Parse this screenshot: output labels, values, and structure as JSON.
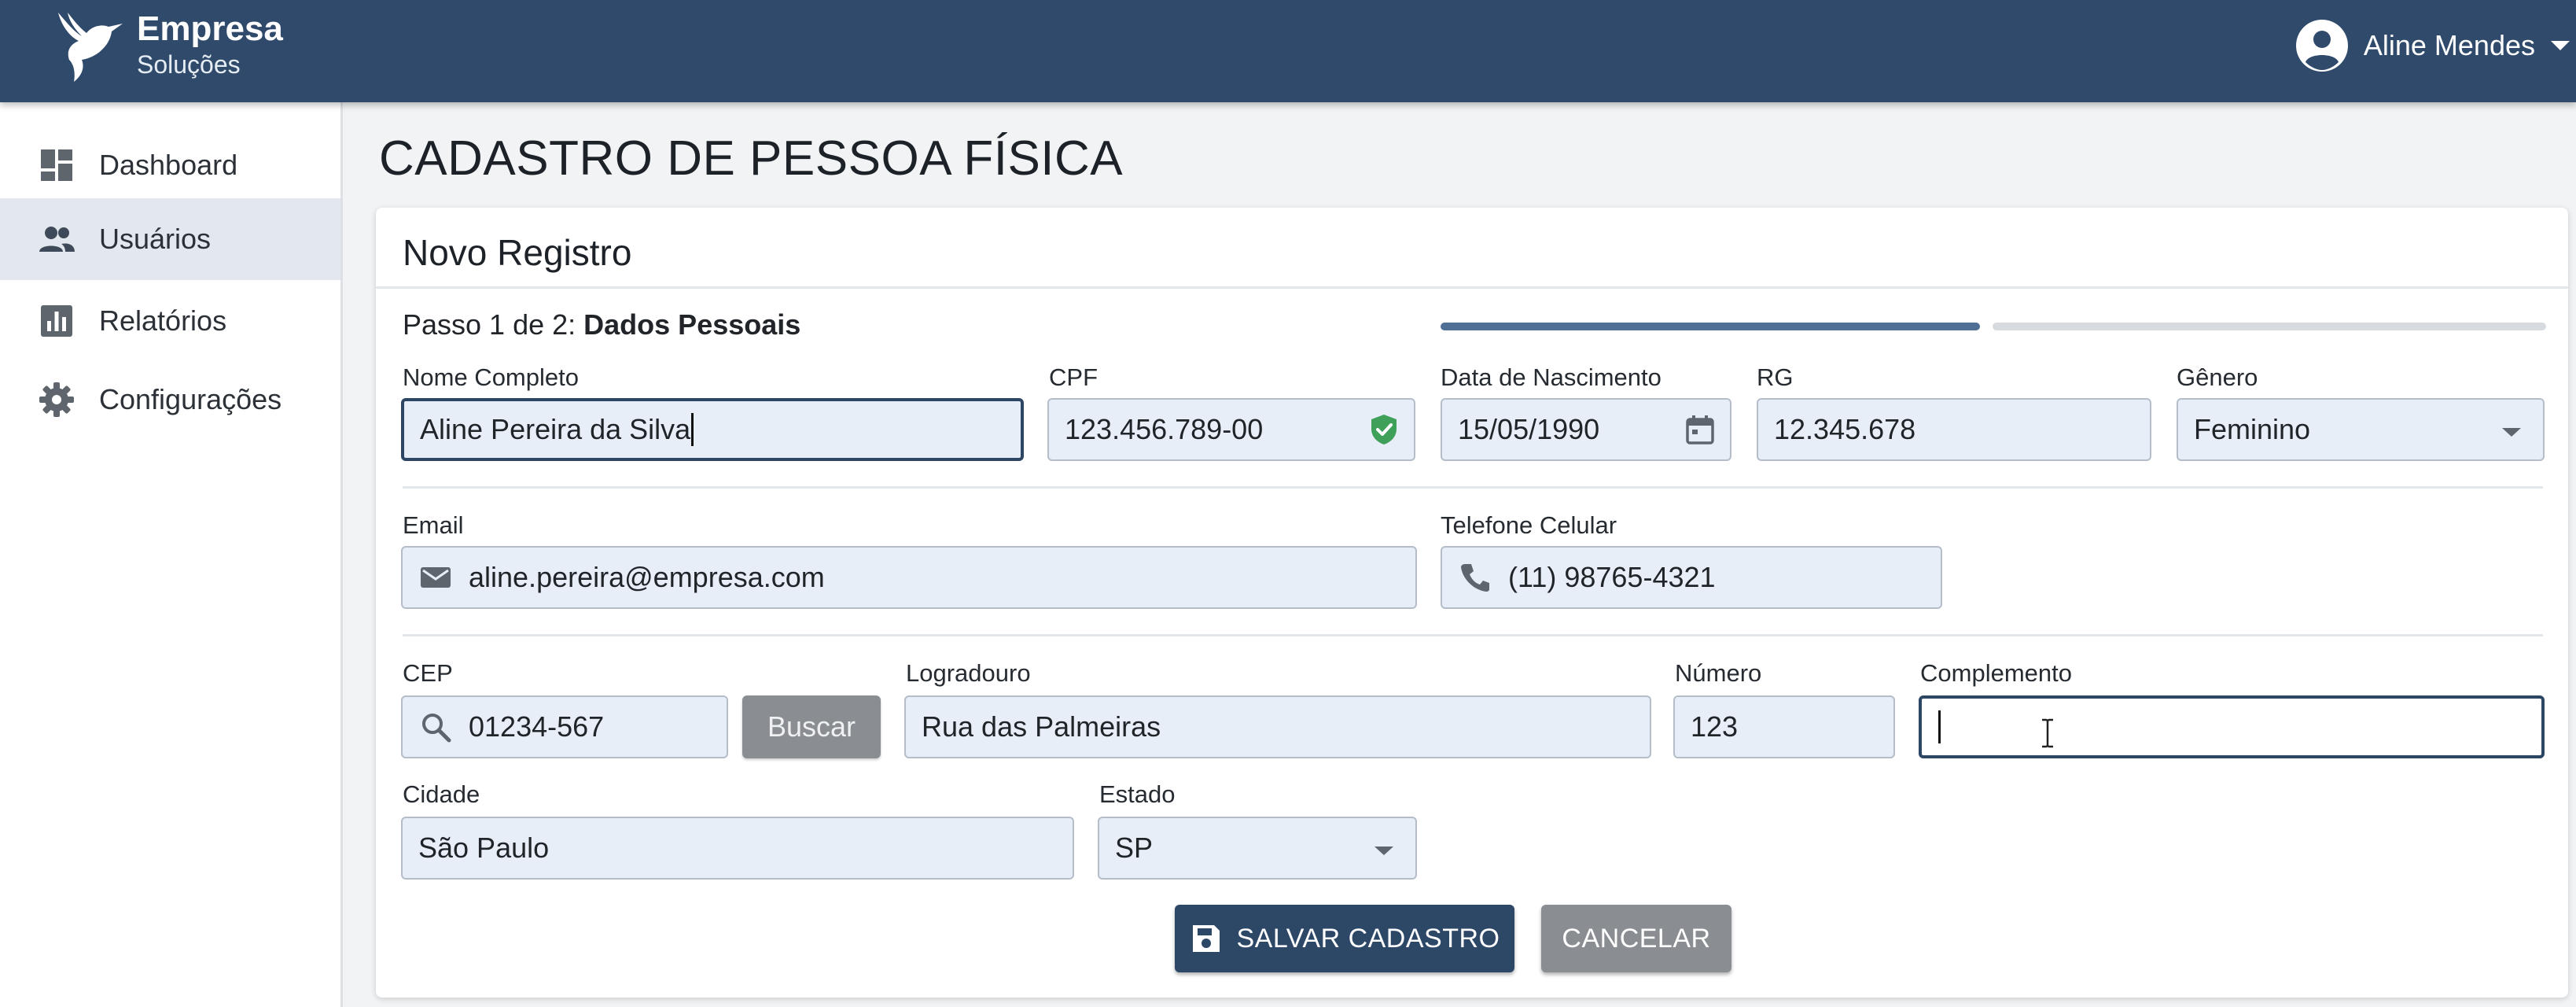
{
  "header": {
    "brand_name": "Empresa",
    "brand_sub": "Soluções",
    "user_name": "Aline Mendes",
    "color": "#2f4a6b"
  },
  "sidebar": {
    "items": [
      {
        "label": "Dashboard",
        "icon": "dashboard-icon",
        "active": false
      },
      {
        "label": "Usuários",
        "icon": "people-icon",
        "active": true
      },
      {
        "label": "Relatórios",
        "icon": "bar-chart-icon",
        "active": false
      },
      {
        "label": "Configurações",
        "icon": "gear-icon",
        "active": false
      }
    ]
  },
  "page": {
    "title": "CADASTRO DE PESSOA FÍSICA"
  },
  "form": {
    "card_title": "Novo Registro",
    "step_prefix": "Passo 1 de 2: ",
    "step_name": "Dados Pessoais",
    "progress_fraction": 0.5,
    "fields": {
      "nome": {
        "label": "Nome Completo",
        "value": "Aline Pereira da Silva"
      },
      "cpf": {
        "label": "CPF",
        "value": "123.456.789-00",
        "icon": "verified-shield-icon"
      },
      "nascimento": {
        "label": "Data de Nascimento",
        "value": "15/05/1990",
        "icon": "calendar-icon"
      },
      "rg": {
        "label": "RG",
        "value": "12.345.678"
      },
      "genero": {
        "label": "Gênero",
        "value": "Feminino"
      },
      "email": {
        "label": "Email",
        "value": "aline.pereira@empresa.com",
        "icon": "mail-icon"
      },
      "telefone": {
        "label": "Telefone Celular",
        "value": "(11) 98765-4321",
        "icon": "phone-icon"
      },
      "cep": {
        "label": "CEP",
        "value": "01234-567",
        "icon": "search-icon"
      },
      "logradouro": {
        "label": "Logradouro",
        "value": "Rua das Palmeiras"
      },
      "numero": {
        "label": "Número",
        "value": "123"
      },
      "complemento": {
        "label": "Complemento",
        "value": ""
      },
      "cidade": {
        "label": "Cidade",
        "value": "São Paulo"
      },
      "estado": {
        "label": "Estado",
        "value": "SP"
      }
    },
    "buscar_label": "Buscar",
    "save_label": "SALVAR CADASTRO",
    "cancel_label": "CANCELAR",
    "accent_color": "#2d4767",
    "valid_color": "#3fa05a"
  }
}
